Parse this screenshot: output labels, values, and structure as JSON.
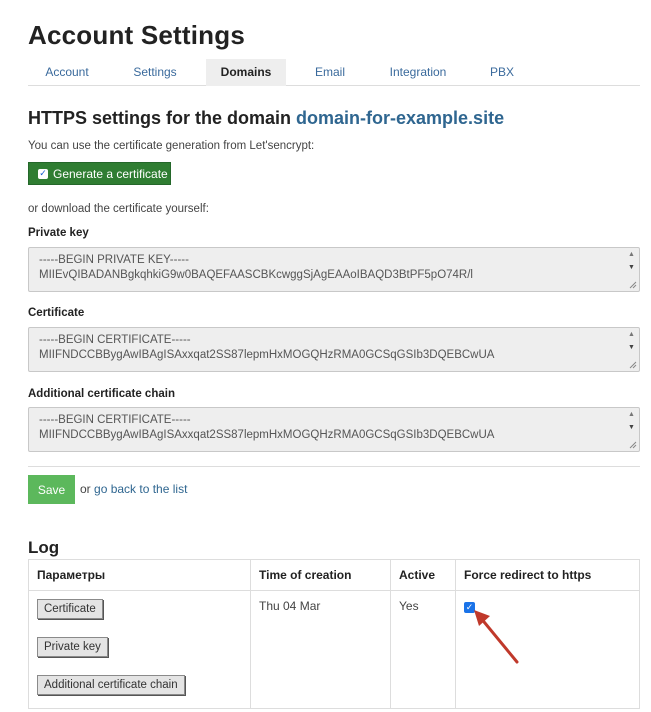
{
  "page": {
    "title": "Account Settings"
  },
  "tabs": [
    {
      "label": "Account",
      "active": false
    },
    {
      "label": "Settings",
      "active": false
    },
    {
      "label": "Domains",
      "active": true
    },
    {
      "label": "Email",
      "active": false
    },
    {
      "label": "Integration",
      "active": false
    },
    {
      "label": "PBX",
      "active": false
    }
  ],
  "https": {
    "heading_prefix": "HTTPS settings for the domain",
    "domain": "domain-for-example.site",
    "letsencrypt_hint": "You can use the certificate generation from Let'sencrypt:",
    "generate_label": "Generate a certificate",
    "generate_checked": true,
    "download_hint": "or download the certificate yourself:",
    "fields": [
      {
        "label": "Private key",
        "lines": [
          "-----BEGIN PRIVATE KEY-----",
          "MIIEvQIBADANBgkqhkiG9w0BAQEFAASCBKcwggSjAgEAAoIBAQD3BtPF5pO74R/l"
        ]
      },
      {
        "label": "Certificate",
        "lines": [
          "-----BEGIN CERTIFICATE-----",
          "MIIFNDCCBBygAwIBAgISAxxqat2SS87lepmHxMOGQHzRMA0GCSqGSIb3DQEBCwUA"
        ]
      },
      {
        "label": "Additional certificate chain",
        "lines": [
          "-----BEGIN CERTIFICATE-----",
          "MIIFNDCCBBygAwIBAgISAxxqat2SS87lepmHxMOGQHzRMA0GCSqGSIb3DQEBCwUA"
        ]
      }
    ],
    "save_label": "Save",
    "or_label": "or",
    "back_link": "go back to the list"
  },
  "log": {
    "title": "Log",
    "columns": [
      "Параметры",
      "Time of creation",
      "Active",
      "Force redirect to https"
    ],
    "row": {
      "buttons": [
        "Certificate",
        "Private key",
        "Additional certificate chain"
      ],
      "time": "Thu 04 Mar",
      "active": "Yes",
      "force_redirect": true
    }
  },
  "colors": {
    "accent_link": "#2f6690",
    "generate_bg": "#2f7d32",
    "save_bg": "#5cb85c",
    "annotation_arrow": "#c0392b"
  }
}
